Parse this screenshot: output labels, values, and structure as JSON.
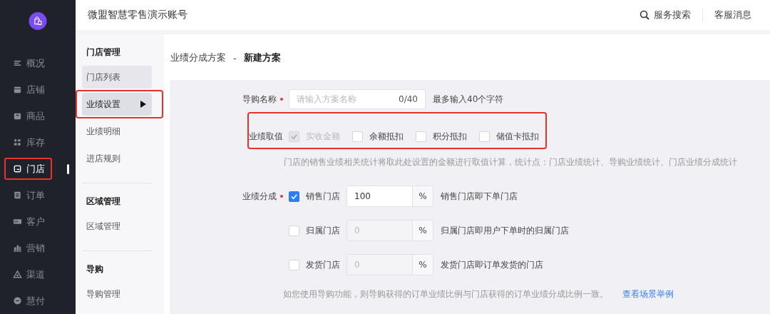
{
  "sidebar": {
    "items": [
      {
        "label": "概况",
        "selected": false,
        "annotated": false
      },
      {
        "label": "店铺",
        "selected": false,
        "annotated": false
      },
      {
        "label": "商品",
        "selected": false,
        "annotated": false
      },
      {
        "label": "库存",
        "selected": false,
        "annotated": false
      },
      {
        "label": "门店",
        "selected": true,
        "annotated": true
      },
      {
        "label": "订单",
        "selected": false,
        "annotated": false
      },
      {
        "label": "客户",
        "selected": false,
        "annotated": false
      },
      {
        "label": "营销",
        "selected": false,
        "annotated": false
      },
      {
        "label": "渠道",
        "selected": false,
        "annotated": false
      },
      {
        "label": "慧付",
        "selected": false,
        "annotated": false
      }
    ]
  },
  "header": {
    "title": "微盟智慧零售演示账号",
    "actions": [
      "服务搜索",
      "客服消息"
    ]
  },
  "subnav": {
    "sections": [
      {
        "title": "门店管理",
        "items": [
          {
            "label": "门店列表",
            "selected": false,
            "hovered": true,
            "annotated": false
          },
          {
            "label": "业绩设置",
            "selected": true,
            "hovered": false,
            "annotated": true
          },
          {
            "label": "业绩明细",
            "selected": false,
            "hovered": false,
            "annotated": false
          },
          {
            "label": "进店规则",
            "selected": false,
            "hovered": false,
            "annotated": false
          }
        ]
      },
      {
        "title": "区域管理",
        "items": [
          {
            "label": "区域管理",
            "selected": false,
            "hovered": false,
            "annotated": false
          }
        ]
      },
      {
        "title": "导购",
        "items": [
          {
            "label": "导购管理",
            "selected": false,
            "hovered": false,
            "annotated": false
          }
        ]
      }
    ]
  },
  "breadcrumb": {
    "parent": "业绩分成方案",
    "separator": "-",
    "current": "新建方案"
  },
  "form": {
    "name_field": {
      "label": "导购名称",
      "required": true,
      "placeholder": "请输入方案名称",
      "counter": "0/40",
      "hint": "最多输入40个字符"
    },
    "value_source": {
      "label": "业绩取值",
      "required": false,
      "annotated": true,
      "options": [
        {
          "label": "实收金额",
          "checked": true,
          "disabled": true
        },
        {
          "label": "余额抵扣",
          "checked": false,
          "disabled": false
        },
        {
          "label": "积分抵扣",
          "checked": false,
          "disabled": false
        },
        {
          "label": "储值卡抵扣",
          "checked": false,
          "disabled": false
        }
      ]
    },
    "value_note": "门店的销售业绩相关统计将取此处设置的金额进行取值计算，统计点：门店业绩统计、导购业绩统计、门店业绩分成统计",
    "split": {
      "label": "业绩分成",
      "required": true,
      "rows": [
        {
          "label": "销售门店",
          "checked": true,
          "value": "100",
          "unit": "%",
          "description": "销售门店即下单门店"
        },
        {
          "label": "归属门店",
          "checked": false,
          "value": "0",
          "unit": "%",
          "description": "归属门店即用户下单时的归属门店"
        },
        {
          "label": "发货门店",
          "checked": false,
          "value": "0",
          "unit": "%",
          "description": "发货门店即订单发货的门店"
        }
      ]
    },
    "footer_note": "如您使用导购功能，则导购获得的订单业绩比例与门店获得的订单业绩分成比例一致。",
    "footer_link": "查看场景举例"
  }
}
